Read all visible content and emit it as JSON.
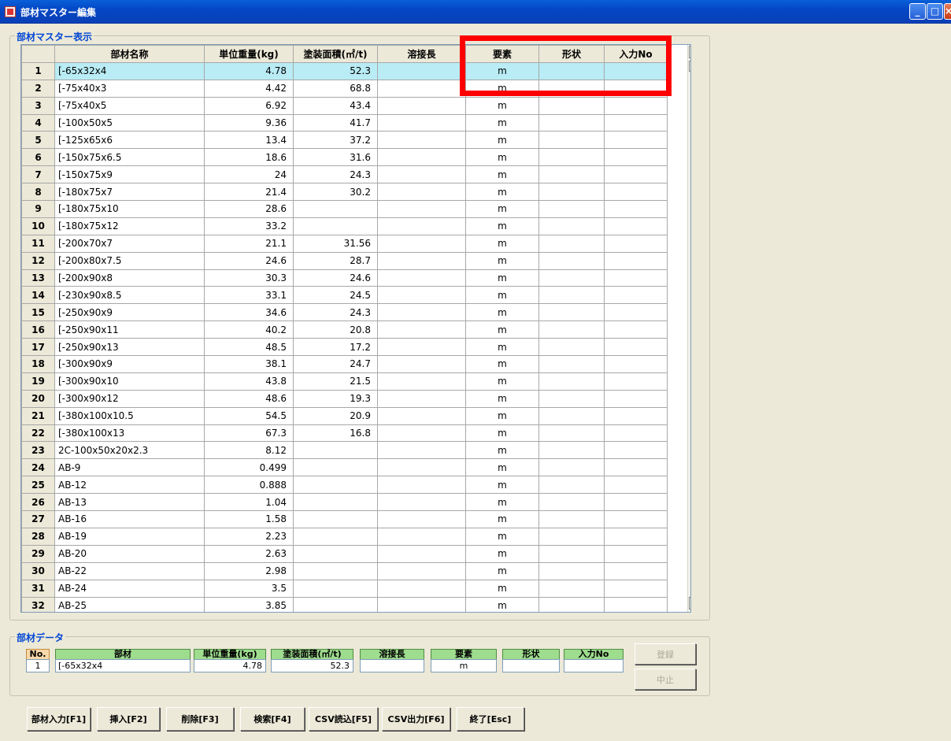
{
  "window": {
    "title": "部材マスター編集"
  },
  "grid_group": {
    "label": "部材マスター表示"
  },
  "grid": {
    "headers": [
      "部材名称",
      "単位重量(kg)",
      "塗装面積(㎡/t)",
      "溶接長",
      "要素",
      "形状",
      "入力No"
    ],
    "rows": [
      [
        "1",
        "[-65x32x4",
        "4.78",
        "52.3",
        "",
        "m",
        "",
        ""
      ],
      [
        "2",
        "[-75x40x3",
        "4.42",
        "68.8",
        "",
        "m",
        "",
        ""
      ],
      [
        "3",
        "[-75x40x5",
        "6.92",
        "43.4",
        "",
        "m",
        "",
        ""
      ],
      [
        "4",
        "[-100x50x5",
        "9.36",
        "41.7",
        "",
        "m",
        "",
        ""
      ],
      [
        "5",
        "[-125x65x6",
        "13.4",
        "37.2",
        "",
        "m",
        "",
        ""
      ],
      [
        "6",
        "[-150x75x6.5",
        "18.6",
        "31.6",
        "",
        "m",
        "",
        ""
      ],
      [
        "7",
        "[-150x75x9",
        "24",
        "24.3",
        "",
        "m",
        "",
        ""
      ],
      [
        "8",
        "[-180x75x7",
        "21.4",
        "30.2",
        "",
        "m",
        "",
        ""
      ],
      [
        "9",
        "[-180x75x10",
        "28.6",
        "",
        "",
        "m",
        "",
        ""
      ],
      [
        "10",
        "[-180x75x12",
        "33.2",
        "",
        "",
        "m",
        "",
        ""
      ],
      [
        "11",
        "[-200x70x7",
        "21.1",
        "31.56",
        "",
        "m",
        "",
        ""
      ],
      [
        "12",
        "[-200x80x7.5",
        "24.6",
        "28.7",
        "",
        "m",
        "",
        ""
      ],
      [
        "13",
        "[-200x90x8",
        "30.3",
        "24.6",
        "",
        "m",
        "",
        ""
      ],
      [
        "14",
        "[-230x90x8.5",
        "33.1",
        "24.5",
        "",
        "m",
        "",
        ""
      ],
      [
        "15",
        "[-250x90x9",
        "34.6",
        "24.3",
        "",
        "m",
        "",
        ""
      ],
      [
        "16",
        "[-250x90x11",
        "40.2",
        "20.8",
        "",
        "m",
        "",
        ""
      ],
      [
        "17",
        "[-250x90x13",
        "48.5",
        "17.2",
        "",
        "m",
        "",
        ""
      ],
      [
        "18",
        "[-300x90x9",
        "38.1",
        "24.7",
        "",
        "m",
        "",
        ""
      ],
      [
        "19",
        "[-300x90x10",
        "43.8",
        "21.5",
        "",
        "m",
        "",
        ""
      ],
      [
        "20",
        "[-300x90x12",
        "48.6",
        "19.3",
        "",
        "m",
        "",
        ""
      ],
      [
        "21",
        "[-380x100x10.5",
        "54.5",
        "20.9",
        "",
        "m",
        "",
        ""
      ],
      [
        "22",
        "[-380x100x13",
        "67.3",
        "16.8",
        "",
        "m",
        "",
        ""
      ],
      [
        "23",
        "2C-100x50x20x2.3",
        "8.12",
        "",
        "",
        "m",
        "",
        ""
      ],
      [
        "24",
        "AB-9",
        "0.499",
        "",
        "",
        "m",
        "",
        ""
      ],
      [
        "25",
        "AB-12",
        "0.888",
        "",
        "",
        "m",
        "",
        ""
      ],
      [
        "26",
        "AB-13",
        "1.04",
        "",
        "",
        "m",
        "",
        ""
      ],
      [
        "27",
        "AB-16",
        "1.58",
        "",
        "",
        "m",
        "",
        ""
      ],
      [
        "28",
        "AB-19",
        "2.23",
        "",
        "",
        "m",
        "",
        ""
      ],
      [
        "29",
        "AB-20",
        "2.63",
        "",
        "",
        "m",
        "",
        ""
      ],
      [
        "30",
        "AB-22",
        "2.98",
        "",
        "",
        "m",
        "",
        ""
      ],
      [
        "31",
        "AB-24",
        "3.5",
        "",
        "",
        "m",
        "",
        ""
      ],
      [
        "32",
        "AB-25",
        "3.85",
        "",
        "",
        "m",
        "",
        ""
      ]
    ],
    "selected_row": 0
  },
  "data_group": {
    "label": "部材データ",
    "labels": {
      "no": "No.",
      "name": "部材",
      "weight": "単位重量(kg)",
      "area": "塗装面積(㎡/t)",
      "weld": "溶接長",
      "element": "要素",
      "shape": "形状",
      "input_no": "入力No"
    },
    "values": {
      "no": "1",
      "name": "[-65x32x4",
      "weight": "4.78",
      "area": "52.3",
      "weld": "",
      "element": "m",
      "shape": "",
      "input_no": ""
    },
    "register_label": "登録",
    "cancel_label": "中止"
  },
  "toolbar": {
    "buttons": [
      "部材入力[F1]",
      "挿入[F2]",
      "削除[F3]",
      "検索[F4]",
      "CSV読込[F5]",
      "CSV出力[F6]",
      "終了[Esc]"
    ]
  },
  "highlight_color": "#ff0000"
}
